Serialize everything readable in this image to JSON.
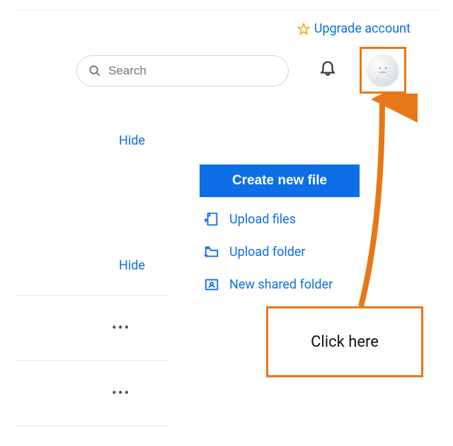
{
  "header": {
    "upgrade_label": "Upgrade account",
    "search_placeholder": "Search"
  },
  "sections": {
    "hide1": "Hide",
    "hide2": "Hide"
  },
  "actions": {
    "create_new_file": "Create new file",
    "upload_files": "Upload files",
    "upload_folder": "Upload folder",
    "new_shared_folder": "New shared folder"
  },
  "list": {
    "more1": "•••",
    "more2": "•••"
  },
  "annotation": {
    "callout_text": "Click here"
  }
}
